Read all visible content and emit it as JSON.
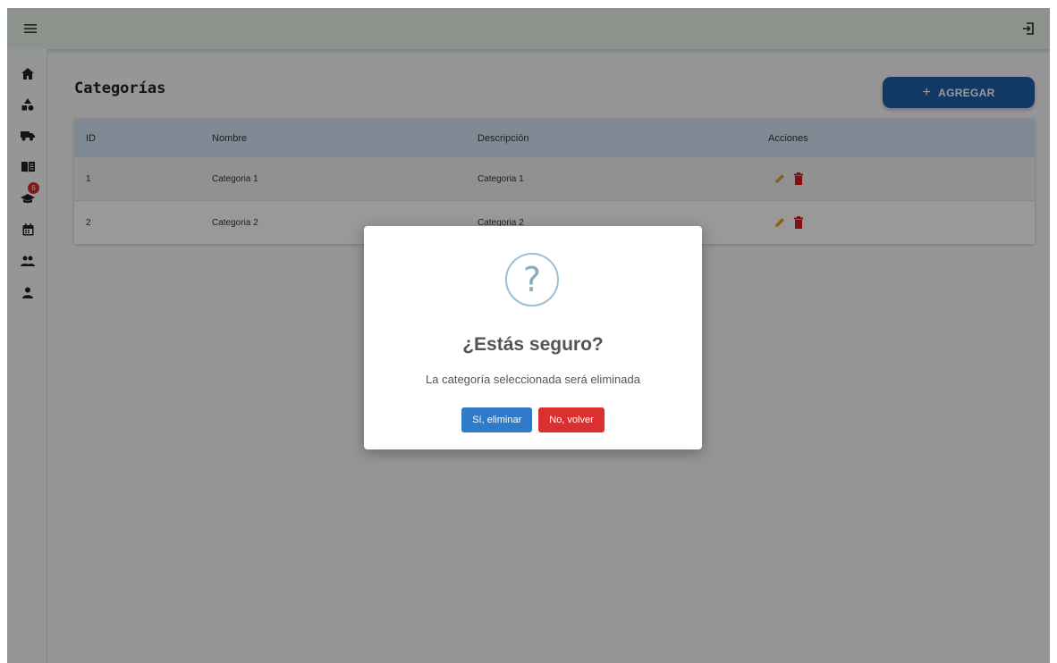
{
  "topbar": {
    "menu_icon": "hamburger-menu-icon",
    "logout_icon": "logout-icon"
  },
  "sidebar": {
    "items": [
      {
        "icon": "home-icon"
      },
      {
        "icon": "shapes-icon"
      },
      {
        "icon": "truck-icon"
      },
      {
        "icon": "book-icon"
      },
      {
        "icon": "graduation-cap-icon",
        "badge": "6"
      },
      {
        "icon": "calendar-icon"
      },
      {
        "icon": "group-icon"
      },
      {
        "icon": "person-icon"
      }
    ]
  },
  "page": {
    "title": "Categorías",
    "add_button_label": "AGREGAR"
  },
  "table": {
    "headers": [
      "ID",
      "Nombre",
      "Descripción",
      "Acciones"
    ],
    "rows": [
      {
        "id": "1",
        "nombre": "Categoria 1",
        "descripcion": "Categoria 1"
      },
      {
        "id": "2",
        "nombre": "Categoria 2",
        "descripcion": "Categoria 2"
      }
    ]
  },
  "dialog": {
    "icon": "?",
    "title": "¿Estás seguro?",
    "text": "La categoría seleccionada será eliminada",
    "confirm_label": "Sí, eliminar",
    "cancel_label": "No, volver"
  },
  "colors": {
    "topbar": "#e8f5e9",
    "primary": "#1e5fa8",
    "danger": "#dc3030",
    "edit": "#e0a020"
  }
}
